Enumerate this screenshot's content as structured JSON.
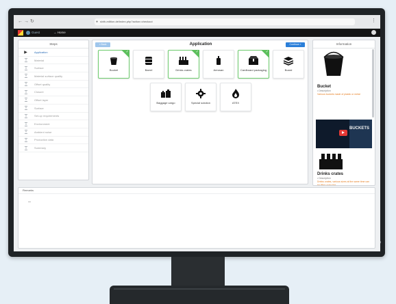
{
  "browser": {
    "url": "sixth-edition.de/index.php?action=checkout",
    "nav_icons": [
      "back-icon",
      "forward-icon",
      "reload-icon"
    ],
    "menu_icon": "menu-dots-icon"
  },
  "appbar": {
    "user": "Guest",
    "home": "Home"
  },
  "steps": {
    "title": "Steps",
    "items": [
      {
        "label": "Application",
        "active": true
      },
      {
        "label": "Material",
        "active": false
      },
      {
        "label": "Surface",
        "active": false
      },
      {
        "label": "Material surface quality",
        "active": false
      },
      {
        "label": "Offset quality",
        "active": false
      },
      {
        "label": "Closure",
        "active": false
      },
      {
        "label": "Offset layer",
        "active": false
      },
      {
        "label": "Surface",
        "active": false
      },
      {
        "label": "Set-up requirements",
        "active": false
      },
      {
        "label": "Environment",
        "active": false
      },
      {
        "label": "Ambient noise",
        "active": false
      },
      {
        "label": "Production data",
        "active": false
      },
      {
        "label": "Summary",
        "active": false
      }
    ]
  },
  "main": {
    "title": "Application",
    "back_label": "« Back",
    "continue_label": "Continue »",
    "tiles": [
      {
        "label": "Bucket",
        "icon": "bucket-icon",
        "selected": true
      },
      {
        "label": "Barrel",
        "icon": "barrel-icon",
        "selected": false
      },
      {
        "label": "Drinks crates",
        "icon": "drinks-crate-icon",
        "selected": true
      },
      {
        "label": "Aerosan",
        "icon": "aerosol-can-icon",
        "selected": false
      },
      {
        "label": "Cardboard packaging",
        "icon": "cardboard-box-icon",
        "selected": true
      },
      {
        "label": "Board",
        "icon": "board-stack-icon",
        "selected": false
      },
      {
        "label": "Baggage cargo",
        "icon": "baggage-icon",
        "selected": false
      },
      {
        "label": "Special solution",
        "icon": "gear-icon",
        "selected": false
      },
      {
        "label": "ATEX",
        "icon": "flame-icon",
        "selected": false
      }
    ]
  },
  "info": {
    "title": "Information",
    "section1": {
      "heading": "Bucket",
      "sub": "• Description",
      "text": "Various buckets made of plastic or metal"
    },
    "video_title": "BUCKETS",
    "section2": {
      "heading": "Drinks crates",
      "sub": "• Description",
      "text": "Drinks crates, various sizes at the same time can be filled using the"
    }
  },
  "remarks": {
    "title": "Remarks"
  },
  "colors": {
    "accent": "#2b7fd9",
    "selected": "#5cbf5c",
    "note": "#e67e22",
    "appbar": "#141414"
  }
}
